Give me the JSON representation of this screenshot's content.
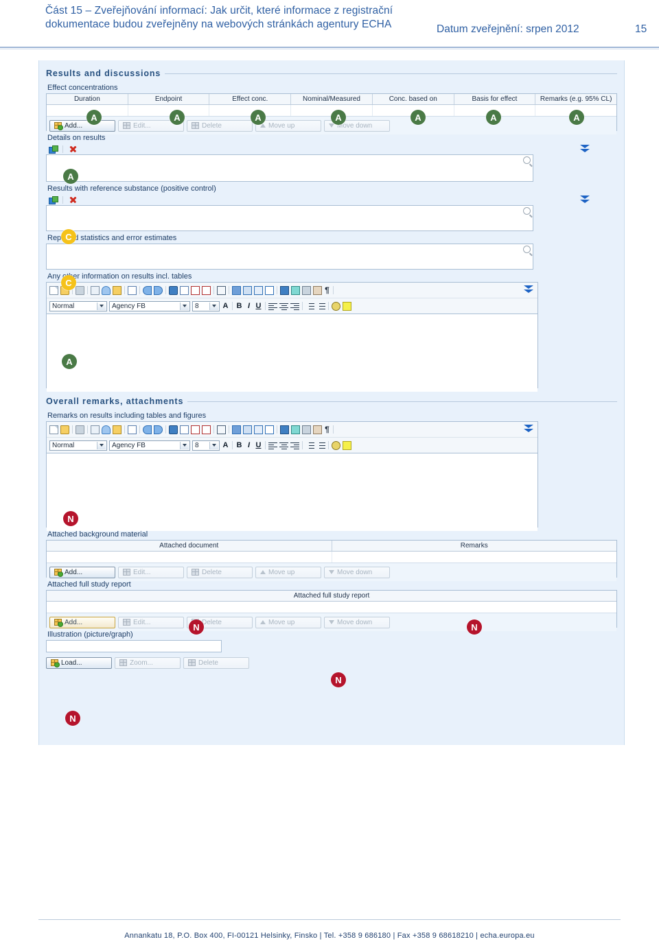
{
  "header": {
    "title": "Část 15 – Zveřejňování informací: Jak určit, které informace z registrační dokumentace budou zveřejněny na webových stránkách agentury ECHA",
    "date_label": "Datum zveřejnění: srpen 2012",
    "page_number": "15"
  },
  "footer": {
    "text": "Annankatu 18, P.O. Box 400, FI-00121 Helsinky, Finsko | Tel. +358 9 686180 | Fax +358 9 68618210 | echa.europa.eu"
  },
  "groups": {
    "results": {
      "title": "Results and discussions"
    },
    "overall": {
      "title": "Overall remarks, attachments"
    }
  },
  "effect_concentrations": {
    "label": "Effect concentrations",
    "columns": [
      "Duration",
      "Endpoint",
      "Effect conc.",
      "Nominal/Measured",
      "Conc. based on",
      "Basis for effect",
      "Remarks (e.g. 95% CL)"
    ],
    "buttons": [
      "Add...",
      "Edit...",
      "Delete",
      "Move up",
      "Move down"
    ],
    "badges": [
      "A",
      "A",
      "A",
      "A",
      "A",
      "A",
      "A"
    ]
  },
  "details_on_results": {
    "label": "Details on results",
    "badge": "A",
    "icons": [
      "import-icon",
      "delete-icon",
      "expand-icon",
      "magnifier-icon"
    ]
  },
  "results_reference_substance": {
    "label": "Results with reference substance (positive control)",
    "badge": "C",
    "icons": [
      "import-icon",
      "delete-icon",
      "expand-icon",
      "magnifier-icon"
    ]
  },
  "reported_statistics": {
    "label": "Reported statistics and error estimates",
    "badge": "C",
    "icons": [
      "magnifier-icon"
    ]
  },
  "any_other_information": {
    "label": "Any other information on results incl. tables",
    "badge": "A",
    "editor": {
      "style_select": "Normal",
      "font_select": "Agency FB",
      "size_select": "8",
      "style_options": [
        "Normal"
      ],
      "font_options": [
        "Agency FB"
      ],
      "size_options": [
        "8"
      ],
      "row1_icons": [
        "new-doc-icon",
        "open-folder-icon",
        "print-icon",
        "copy-icon",
        "cut-icon",
        "paste-icon",
        "insert-table-icon",
        "undo-icon",
        "redo-icon",
        "spellcheck-icon",
        "table-grid-icon",
        "table-header-icon",
        "table-border-icon",
        "split-cell-icon",
        "cell-fill-blue-icon",
        "cell-fill-light-icon",
        "cell-fill-lighter-icon",
        "cell-fill-white-icon",
        "grid-lines-icon",
        "table-props-icon",
        "image-table-icon",
        "image-table2-icon",
        "pilcrow-icon",
        "expand-icon"
      ],
      "row2_icons": [
        "font-color-icon",
        "bold-icon",
        "italic-icon",
        "underline-icon",
        "align-left-icon",
        "align-center-icon",
        "align-right-icon",
        "ordered-list-icon",
        "bullet-list-icon",
        "find-icon",
        "highlight-icon"
      ],
      "bold_label": "B",
      "italic_label": "I",
      "underline_label": "U"
    }
  },
  "remarks_on_results": {
    "label": "Remarks on results including tables and figures",
    "badge": "N",
    "editor": {
      "style_select": "Normal",
      "font_select": "Agency FB",
      "size_select": "8",
      "bold_label": "B",
      "italic_label": "I",
      "underline_label": "U"
    }
  },
  "attached_background_material": {
    "label": "Attached background material",
    "columns": [
      "Attached document",
      "Remarks"
    ],
    "buttons": [
      "Add...",
      "Edit...",
      "Delete",
      "Move up",
      "Move down"
    ],
    "badges": [
      "N",
      "N"
    ]
  },
  "attached_full_study_report": {
    "label": "Attached full study report",
    "columns": [
      "Attached full study report"
    ],
    "buttons": [
      "Add...",
      "Edit...",
      "Delete",
      "Move up",
      "Move down"
    ],
    "badges": [
      "N"
    ]
  },
  "illustration": {
    "label": "Illustration (picture/graph)",
    "badge": "N",
    "value": "",
    "buttons": [
      "Load...",
      "Zoom...",
      "Delete"
    ]
  },
  "colors": {
    "badge_a": "#4a7a46",
    "badge_c": "#f5c21a",
    "badge_n": "#b5142c",
    "panel_bg": "#e8f1fb",
    "header_blue": "#2e5fa3"
  }
}
